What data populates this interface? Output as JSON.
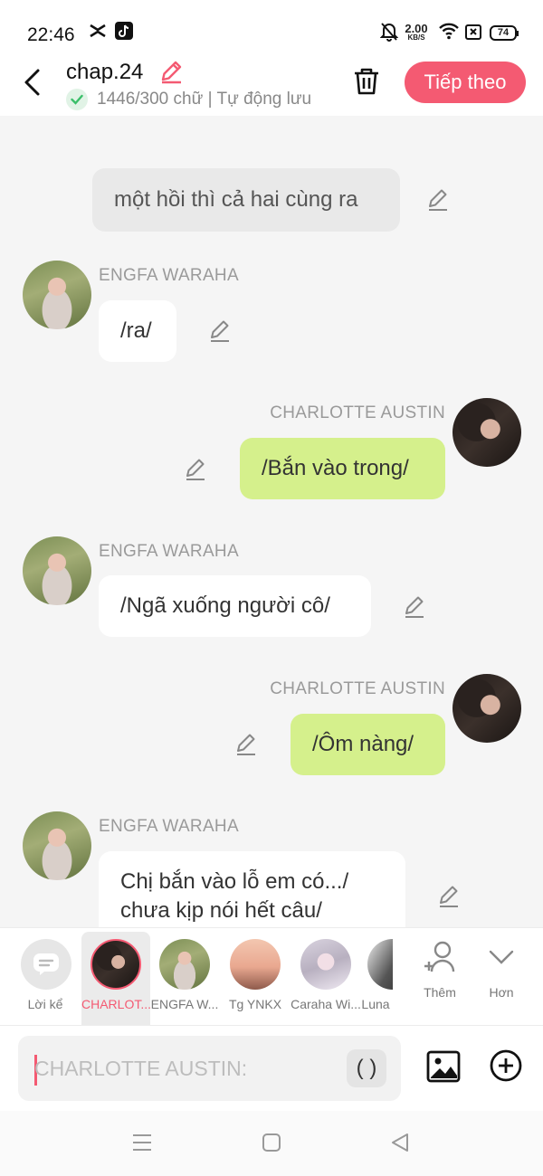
{
  "status": {
    "time": "22:46",
    "net_speed": "2.00",
    "net_unit": "KB/S",
    "battery": "74"
  },
  "header": {
    "title": "chap.24",
    "subtitle": "1446/300 chữ | Tự động lưu",
    "next_label": "Tiếp theo"
  },
  "colors": {
    "accent": "#f45a72",
    "bubble_green": "#d5f08c",
    "bubble_white": "#ffffff",
    "bubble_gray": "#e9e9e9"
  },
  "messages": [
    {
      "type": "narration",
      "text": "một hồi thì cả hai cùng ra"
    },
    {
      "type": "left",
      "name": "ENGFA WARAHA",
      "text": "/ra/"
    },
    {
      "type": "right",
      "name": "CHARLOTTE AUSTIN",
      "text": "/Bắn vào trong/"
    },
    {
      "type": "left",
      "name": "ENGFA WARAHA",
      "text": "/Ngã xuống người cô/"
    },
    {
      "type": "right",
      "name": "CHARLOTTE AUSTIN",
      "text": "/Ôm nàng/"
    },
    {
      "type": "left",
      "name": "ENGFA WARAHA",
      "text": "Chị bắn vào lỗ em có.../ chưa kịp nói hết câu/"
    }
  ],
  "characters": [
    {
      "label": "Lời kể"
    },
    {
      "label": "CHARLOT..."
    },
    {
      "label": "ENGFA W..."
    },
    {
      "label": "Tg YNKX"
    },
    {
      "label": "Caraha Wi..."
    },
    {
      "label": "Luna"
    }
  ],
  "actions": {
    "add_label": "Thêm",
    "more_label": "Hơn"
  },
  "input": {
    "placeholder": "CHARLOTTE AUSTIN:",
    "paren_label": "( )"
  }
}
